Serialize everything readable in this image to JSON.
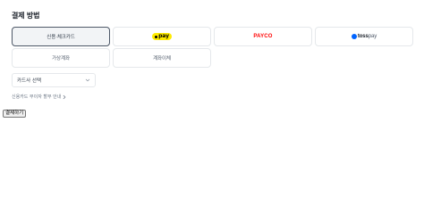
{
  "section": {
    "title": "결제 방법"
  },
  "methods": {
    "card": {
      "label": "신용·체크카드",
      "selected": true
    },
    "kakaopay": {
      "label": "pay",
      "brand_color": "#ffeb00"
    },
    "payco": {
      "label": "PAYCO",
      "brand_color": "#ff0000"
    },
    "tosspay": {
      "label_bold": "toss",
      "label_light": "pay",
      "brand_color": "#0064ff"
    },
    "virtual_account": {
      "label": "가상계좌"
    },
    "bank_transfer": {
      "label": "계좌이체"
    }
  },
  "card_select": {
    "value": "카드사 선택",
    "icon": "chevron-down-icon"
  },
  "info_link": {
    "label": "신용카드 무이자 할부 안내",
    "icon": "chevron-right-icon"
  },
  "submit": {
    "label": "결제하기"
  }
}
